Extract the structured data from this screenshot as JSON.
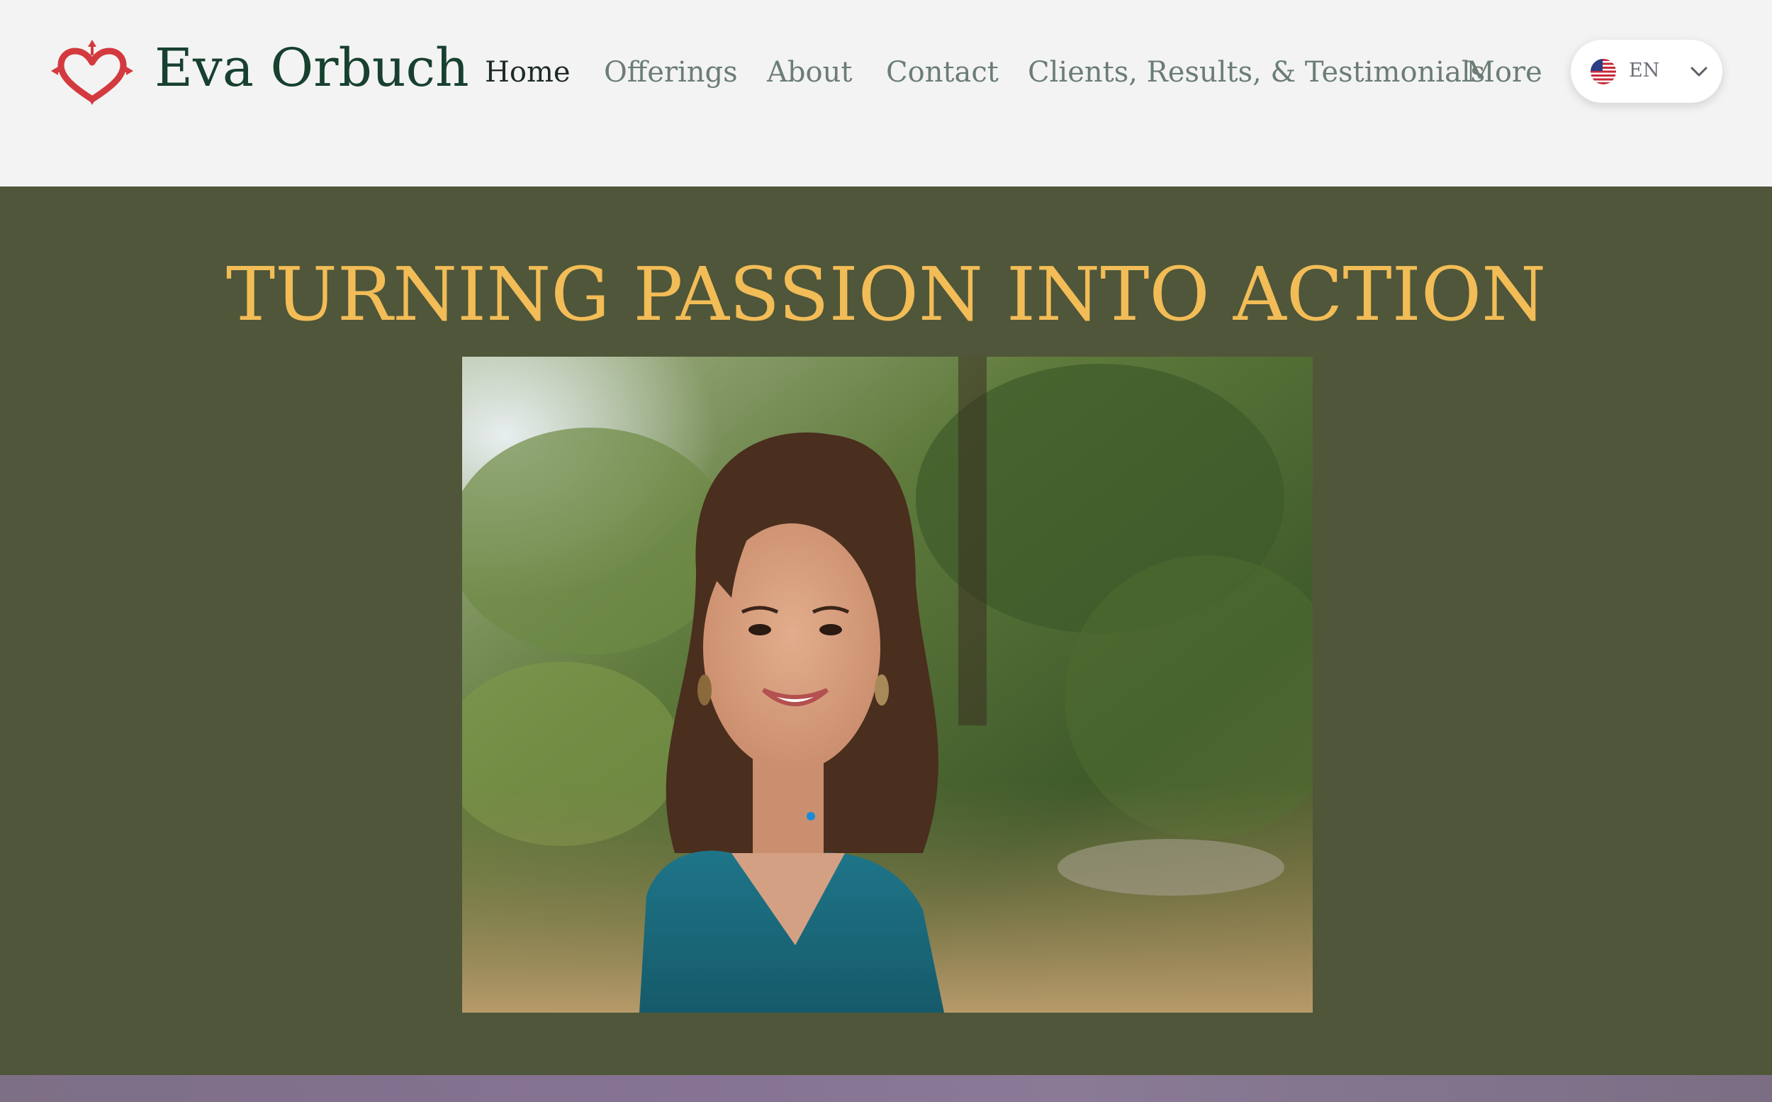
{
  "header": {
    "brand": "Eva Orbuch",
    "logo_icon": "heart-compass-icon",
    "nav": [
      {
        "label": "Home",
        "active": true
      },
      {
        "label": "Offerings",
        "active": false
      },
      {
        "label": "About",
        "active": false
      },
      {
        "label": "Contact",
        "active": false
      },
      {
        "label": "Clients, Results, & Testimonials",
        "active": false
      },
      {
        "label": "More",
        "active": false
      }
    ],
    "language": {
      "code": "EN",
      "flag_icon": "us-flag-icon",
      "dropdown_icon": "chevron-down-icon"
    }
  },
  "hero": {
    "title": "TURNING PASSION INTO ACTION",
    "photo_alt": "portrait-photo"
  },
  "colors": {
    "header_bg": "#f3f3f3",
    "brand_text": "#17402f",
    "nav_text": "#6b7d74",
    "nav_active": "#1e2a26",
    "logo_red": "#d33a3f",
    "hero_bg": "#4f5639",
    "hero_title": "#f2bc57",
    "bottom_strip": "#867394"
  }
}
